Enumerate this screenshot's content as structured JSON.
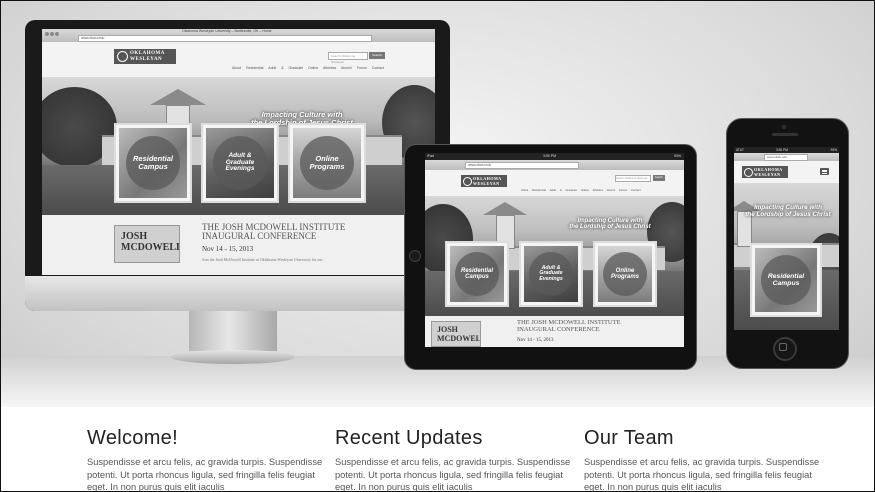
{
  "site": {
    "logo_line1": "OKLAHOMA",
    "logo_line2": "WESLEYAN",
    "browser_title": "Oklahoma Wesleyan University – Bartlesville, OK – Home",
    "url": "www.okwu.edu",
    "search_placeholder": "Search Oklahoma Wesleyan",
    "search_button": "Search",
    "nav": [
      "About",
      "Residential",
      "Adult & Graduate",
      "Online",
      "Athletics",
      "Alumni",
      "Forum",
      "Contact"
    ],
    "tagline_line1": "Impacting Culture with",
    "tagline_line2": "the Lordship of Jesus Christ",
    "cards": [
      {
        "line1": "Residential",
        "line2": "Campus"
      },
      {
        "line1": "Adult &",
        "line2": "Graduate",
        "line3": "Evenings"
      },
      {
        "line1": "Online",
        "line2": "Programs"
      }
    ],
    "event_img_line1": "JOSH",
    "event_img_line2": "MCDOWELL",
    "event_title_line1": "THE JOSH MCDOWELL INSTITUTE",
    "event_title_line2": "INAUGURAL CONFERENCE",
    "event_date": "Nov 14 - 15, 2013",
    "event_desc": "Join the Josh McDowell Institute at Oklahoma Wesleyan University for our",
    "phone_time": "3:50 PM",
    "phone_carrier": "AT&T",
    "phone_battery": "93%",
    "tablet_status_left": "iPad",
    "tablet_status_time": "3:50 PM",
    "tablet_status_right": "93%"
  },
  "columns": [
    {
      "title": "Welcome!",
      "body": "Suspendisse et arcu felis, ac gravida turpis. Suspendisse potenti. Ut porta rhoncus ligula, sed fringilla felis feugiat eget. In non purus quis elit iaculis"
    },
    {
      "title": "Recent Updates",
      "body": "Suspendisse et arcu felis, ac gravida turpis. Suspendisse potenti. Ut porta rhoncus ligula, sed fringilla felis feugiat eget. In non purus quis elit iaculis"
    },
    {
      "title": "Our Team",
      "body": "Suspendisse et arcu felis, ac gravida turpis. Suspendisse potenti. Ut porta rhoncus ligula, sed fringilla felis feugiat eget. In non purus quis elit iaculis"
    }
  ]
}
